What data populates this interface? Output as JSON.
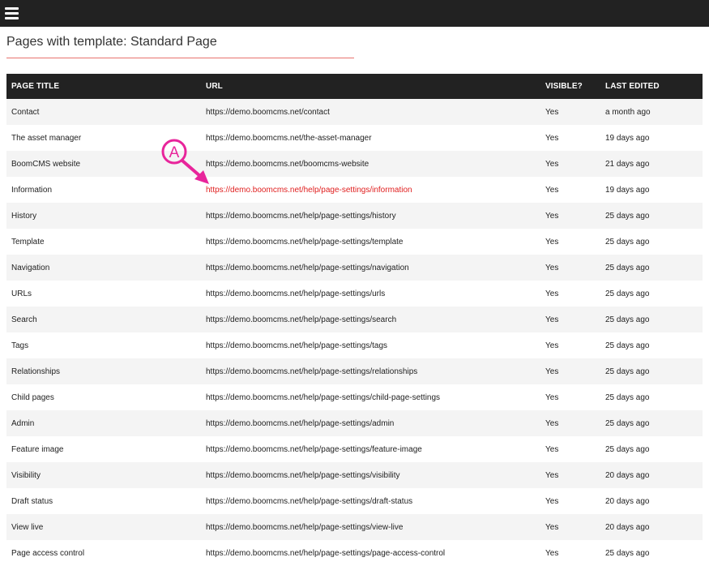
{
  "header": {
    "menu_icon": "hamburger-menu-icon"
  },
  "page": {
    "title": "Pages with template: Standard Page"
  },
  "table": {
    "columns": [
      "PAGE TITLE",
      "URL",
      "VISIBLE?",
      "LAST EDITED"
    ],
    "rows": [
      {
        "title": "Contact",
        "url": "https://demo.boomcms.net/contact",
        "visible": "Yes",
        "edited": "a month ago"
      },
      {
        "title": "The asset manager",
        "url": "https://demo.boomcms.net/the-asset-manager",
        "visible": "Yes",
        "edited": "19 days ago"
      },
      {
        "title": "BoomCMS website",
        "url": "https://demo.boomcms.net/boomcms-website",
        "visible": "Yes",
        "edited": "21 days ago"
      },
      {
        "title": "Information",
        "url": "https://demo.boomcms.net/help/page-settings/information",
        "visible": "Yes",
        "edited": "19 days ago",
        "highlighted": true
      },
      {
        "title": "History",
        "url": "https://demo.boomcms.net/help/page-settings/history",
        "visible": "Yes",
        "edited": "25 days ago"
      },
      {
        "title": "Template",
        "url": "https://demo.boomcms.net/help/page-settings/template",
        "visible": "Yes",
        "edited": "25 days ago"
      },
      {
        "title": "Navigation",
        "url": "https://demo.boomcms.net/help/page-settings/navigation",
        "visible": "Yes",
        "edited": "25 days ago"
      },
      {
        "title": "URLs",
        "url": "https://demo.boomcms.net/help/page-settings/urls",
        "visible": "Yes",
        "edited": "25 days ago"
      },
      {
        "title": "Search",
        "url": "https://demo.boomcms.net/help/page-settings/search",
        "visible": "Yes",
        "edited": "25 days ago"
      },
      {
        "title": "Tags",
        "url": "https://demo.boomcms.net/help/page-settings/tags",
        "visible": "Yes",
        "edited": "25 days ago"
      },
      {
        "title": "Relationships",
        "url": "https://demo.boomcms.net/help/page-settings/relationships",
        "visible": "Yes",
        "edited": "25 days ago"
      },
      {
        "title": "Child pages",
        "url": "https://demo.boomcms.net/help/page-settings/child-page-settings",
        "visible": "Yes",
        "edited": "25 days ago"
      },
      {
        "title": "Admin",
        "url": "https://demo.boomcms.net/help/page-settings/admin",
        "visible": "Yes",
        "edited": "25 days ago"
      },
      {
        "title": "Feature image",
        "url": "https://demo.boomcms.net/help/page-settings/feature-image",
        "visible": "Yes",
        "edited": "25 days ago"
      },
      {
        "title": "Visibility",
        "url": "https://demo.boomcms.net/help/page-settings/visibility",
        "visible": "Yes",
        "edited": "20 days ago"
      },
      {
        "title": "Draft status",
        "url": "https://demo.boomcms.net/help/page-settings/draft-status",
        "visible": "Yes",
        "edited": "20 days ago"
      },
      {
        "title": "View live",
        "url": "https://demo.boomcms.net/help/page-settings/view-live",
        "visible": "Yes",
        "edited": "20 days ago"
      },
      {
        "title": "Page access control",
        "url": "https://demo.boomcms.net/help/page-settings/page-access-control",
        "visible": "Yes",
        "edited": "25 days ago"
      }
    ]
  },
  "annotation": {
    "label": "A",
    "color": "#e8259b"
  },
  "colors": {
    "topbar": "#222222",
    "highlight_link": "#e02020",
    "title_rule": "#e8736f"
  }
}
